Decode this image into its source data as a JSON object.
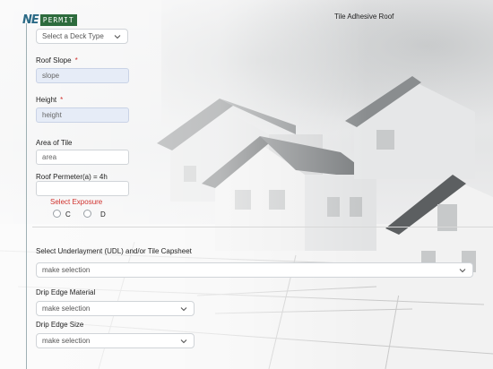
{
  "app": {
    "logo_prefix": "NE",
    "logo_suffix": "PERMIT",
    "title": "Tile Adhesive Roof"
  },
  "deck_type": {
    "value": "Select a Deck Type"
  },
  "roof_slope": {
    "label": "Roof Slope",
    "required": "*",
    "placeholder": "slope"
  },
  "height": {
    "label": "Height",
    "required": "*",
    "placeholder": "height"
  },
  "area_of_tile": {
    "label": "Area of Tile",
    "placeholder": "area"
  },
  "roof_perimeter": {
    "label": "Roof Permeter(a) = 4h",
    "value": ""
  },
  "exposure": {
    "label": "Select Exposure",
    "options": [
      "C",
      "D"
    ]
  },
  "underlayment": {
    "label": "Select Underlayment (UDL) and/or Tile Capsheet",
    "value": "make selection"
  },
  "drip_edge_material": {
    "label": "Drip Edge Material",
    "value": "make selection"
  },
  "drip_edge_size": {
    "label": "Drip Edge Size",
    "value": "make selection"
  },
  "colors": {
    "accent_green": "#2d6b3d",
    "logo_blue": "#2b6a86",
    "required_red": "#d0312d",
    "filled_input": "#e6ecf7"
  }
}
